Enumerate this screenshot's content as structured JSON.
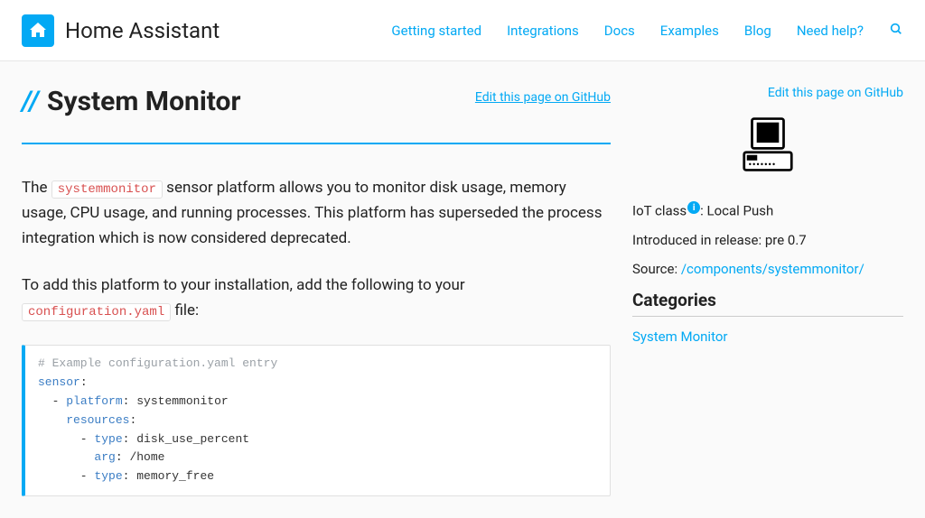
{
  "brand": {
    "name": "Home Assistant"
  },
  "nav": {
    "getting_started": "Getting started",
    "integrations": "Integrations",
    "docs": "Docs",
    "examples": "Examples",
    "blog": "Blog",
    "need_help": "Need help?"
  },
  "page": {
    "title": "System Monitor",
    "slashes": "//",
    "edit_link": "Edit this page on GitHub",
    "intro_before": "The ",
    "intro_code": "systemmonitor",
    "intro_after": " sensor platform allows you to monitor disk usage, memory usage, CPU usage, and running processes. This platform has superseded the process integration which is now considered deprecated.",
    "add_before": "To add this platform to your installation, add the following to your ",
    "add_code": "configuration.yaml",
    "add_after": " file:"
  },
  "code": {
    "comment": "# Example configuration.yaml entry",
    "l1_key": "sensor",
    "l1_colon": ":",
    "l2_prefix": "  - ",
    "l2_key": "platform",
    "l2_sep": ": ",
    "l2_val": "systemmonitor",
    "l3_prefix": "    ",
    "l3_key": "resources",
    "l3_colon": ":",
    "l4_prefix": "      - ",
    "l4_key": "type",
    "l4_sep": ": ",
    "l4_val": "disk_use_percent",
    "l5_prefix": "        ",
    "l5_key": "arg",
    "l5_sep": ": ",
    "l5_val": "/home",
    "l6_prefix": "      - ",
    "l6_key": "type",
    "l6_sep": ": ",
    "l6_val": "memory_free"
  },
  "sidebar": {
    "edit_link": "Edit this page on GitHub",
    "iot_label": "IoT class",
    "iot_sep": ": ",
    "iot_value": "Local Push",
    "intro_label": "Introduced in release: ",
    "intro_value": "pre 0.7",
    "source_label": "Source: ",
    "source_value": "/components/systemmonitor/",
    "categories_heading": "Categories",
    "category_link": "System Monitor"
  }
}
